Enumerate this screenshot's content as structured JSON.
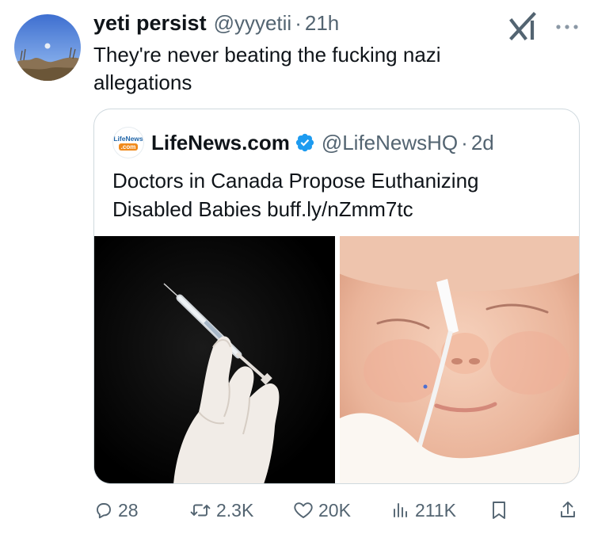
{
  "tweet": {
    "display_name": "yeti persist",
    "handle": "@yyyetii",
    "separator": "·",
    "time": "21h",
    "text": "They're never beating the fucking nazi allegations"
  },
  "quote": {
    "avatar_text_top": "LifeNews",
    "avatar_text_bottom": ".com",
    "display_name": "LifeNews.com",
    "verified": true,
    "handle": "@LifeNewsHQ",
    "separator": "·",
    "time": "2d",
    "text": "Doctors in Canada Propose Euthanizing Disabled Babies buff.ly/nZmm7tc",
    "media": [
      {
        "description": "gloved hand holding syringe on black background"
      },
      {
        "description": "sleeping newborn baby with feeding tube"
      }
    ]
  },
  "actions": {
    "replies": "28",
    "reposts": "2.3K",
    "likes": "20K",
    "views": "211K"
  },
  "colors": {
    "text": "#0f1419",
    "secondary": "#536471",
    "border": "#cfd9de",
    "verified": "#1d9bf0"
  },
  "icons": [
    "grok-icon",
    "more-icon",
    "verified-icon",
    "reply-icon",
    "repost-icon",
    "like-icon",
    "views-icon",
    "bookmark-icon",
    "share-icon"
  ]
}
